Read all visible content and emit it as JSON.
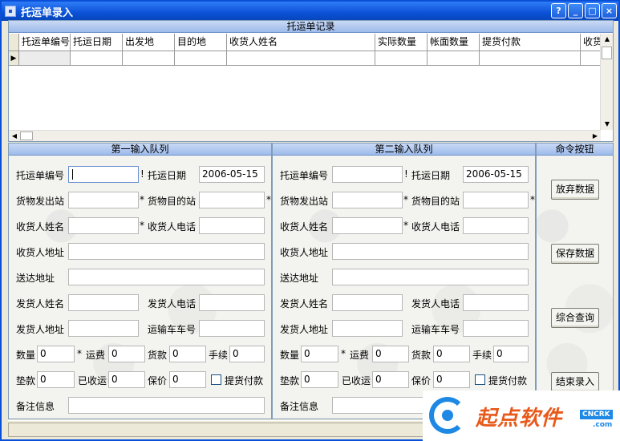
{
  "window": {
    "title": "托运单录入",
    "buttons": [
      "?",
      "_",
      "□",
      "×"
    ]
  },
  "grid": {
    "caption": "托运单记录",
    "columns": [
      "托运单编号",
      "托运日期",
      "出发地",
      "目的地",
      "收货人姓名",
      "实际数量",
      "帐面数量",
      "提货付款",
      "收货"
    ],
    "row_indicator": "▶"
  },
  "queue1": {
    "caption": "第一输入队列",
    "labels": {
      "waybill_no": "托运单编号",
      "ship_date": "托运日期",
      "origin": "货物发出站",
      "destination": "货物目的站",
      "consignee_name": "收货人姓名",
      "consignee_phone": "收货人电话",
      "consignee_addr": "收货人地址",
      "delivery_addr": "送达地址",
      "shipper_name": "发货人姓名",
      "shipper_phone": "发货人电话",
      "shipper_addr": "发货人地址",
      "truck_no": "运输车车号",
      "qty": "数量",
      "freight": "运费",
      "goods_payment": "货款",
      "fee": "手续",
      "advance": "垫款",
      "collected": "已收运",
      "insured": "保价",
      "pay_on_pickup": "提货付款",
      "remarks": "备注信息"
    },
    "values": {
      "ship_date": "2006-05-15",
      "qty": "0",
      "freight": "0",
      "goods_payment": "0",
      "fee": "0",
      "advance": "0",
      "collected": "0",
      "insured": "0"
    },
    "required_mark": "*",
    "separator": "!"
  },
  "queue2": {
    "caption": "第二输入队列",
    "values": {
      "ship_date": "2006-05-15",
      "qty": "0",
      "freight": "0",
      "goods_payment": "0",
      "fee": "0",
      "advance": "0",
      "collected": "0",
      "insured": "0"
    }
  },
  "commands": {
    "caption": "命令按钮",
    "discard": "放弃数据",
    "save": "保存数据",
    "query": "综合查询",
    "finish": "结束录入"
  },
  "watermark": {
    "brand": "起点软件",
    "tag": "CNCRK",
    "domain": ".com"
  }
}
